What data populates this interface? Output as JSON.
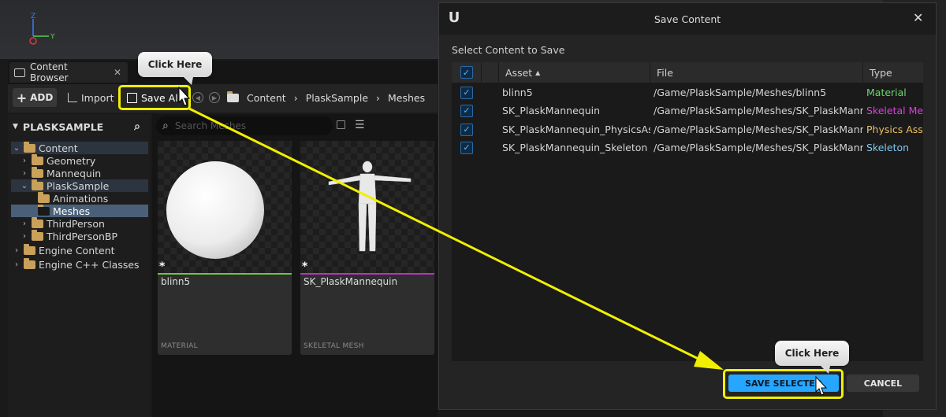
{
  "content_browser": {
    "tab_title": "Content Browser",
    "toolbar": {
      "add_label": "ADD",
      "import_label": "Import",
      "save_all_label": "Save All"
    },
    "breadcrumbs": [
      "Content",
      "PlaskSample",
      "Meshes"
    ],
    "tree": {
      "root_label": "PLASKSAMPLE",
      "items": [
        {
          "label": "Content"
        },
        {
          "label": "Geometry"
        },
        {
          "label": "Mannequin"
        },
        {
          "label": "PlaskSample"
        },
        {
          "label": "Animations"
        },
        {
          "label": "Meshes"
        },
        {
          "label": "ThirdPerson"
        },
        {
          "label": "ThirdPersonBP"
        },
        {
          "label": "Engine Content"
        },
        {
          "label": "Engine C++ Classes"
        }
      ]
    },
    "search_placeholder": "Search Meshes",
    "assets": [
      {
        "name": "blinn5",
        "type": "MATERIAL",
        "accent": "#6cc644"
      },
      {
        "name": "SK_PlaskMannequin",
        "type": "SKELETAL MESH",
        "accent": "#c12ec1"
      }
    ]
  },
  "dialog": {
    "title": "Save Content",
    "instruction": "Select Content to Save",
    "columns": {
      "asset": "Asset",
      "file": "File",
      "type": "Type"
    },
    "rows": [
      {
        "asset": "blinn5",
        "file": "/Game/PlaskSample/Meshes/blinn5",
        "type": "Material",
        "type_color": "#6fd66f"
      },
      {
        "asset": "SK_PlaskMannequin",
        "file": "/Game/PlaskSample/Meshes/SK_PlaskMannequin",
        "type": "Skeletal Mesh",
        "type_color": "#e03ee0"
      },
      {
        "asset": "SK_PlaskMannequin_PhysicsAsset",
        "file": "/Game/PlaskSample/Meshes/SK_PlaskMannequin_PhysicsAsset",
        "type": "Physics Asset",
        "type_color": "#e8c069"
      },
      {
        "asset": "SK_PlaskMannequin_Skeleton",
        "file": "/Game/PlaskSample/Meshes/SK_PlaskMannequin_Skeleton",
        "type": "Skeleton",
        "type_color": "#7ec8ee"
      }
    ],
    "save_selected_label": "SAVE SELECTED",
    "cancel_label": "CANCEL"
  },
  "annotations": {
    "tip_1": "Click Here",
    "tip_2": "Click Here",
    "highlight_color": "#f0f000"
  },
  "viewport": {
    "axis_z": "Z",
    "axis_y": "Y"
  }
}
